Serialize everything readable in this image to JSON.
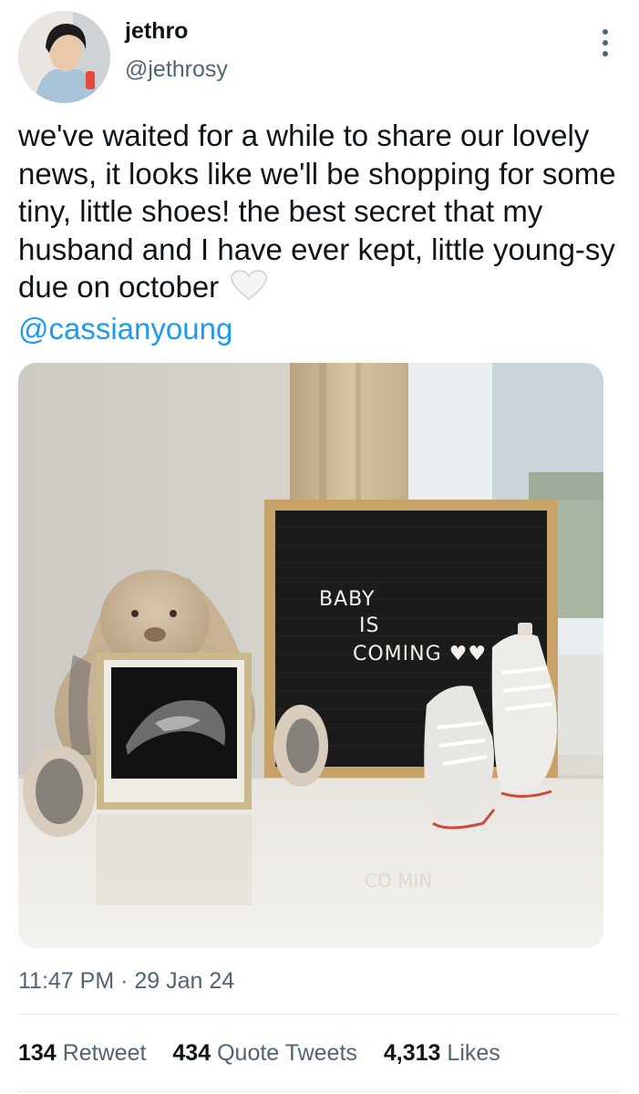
{
  "user": {
    "display_name": "jethro",
    "handle": "@jethrosy"
  },
  "tweet": {
    "text": "we've waited for a while to share our lovely news, it looks like we'll be shopping for some tiny, little shoes! the best secret that my husband and I have ever kept, little young-sy due on october",
    "mention": "@cassianyoung",
    "emoji": "white-heart"
  },
  "photo": {
    "letter_board": [
      "BABY",
      "IS",
      "COMING ♥♥"
    ],
    "reflection_text": "CO MIN"
  },
  "meta": {
    "timestamp": "11:47 PM · 29 Jan 24"
  },
  "stats": {
    "retweets": "134",
    "retweets_label": "Retweet",
    "quotes": "434",
    "quotes_label": "Quote Tweets",
    "likes": "4,313",
    "likes_label": "Likes"
  },
  "colors": {
    "text": "#0f1419",
    "secondary": "#536471",
    "link": "#1d9bf0",
    "divider": "#e6ecf0"
  }
}
